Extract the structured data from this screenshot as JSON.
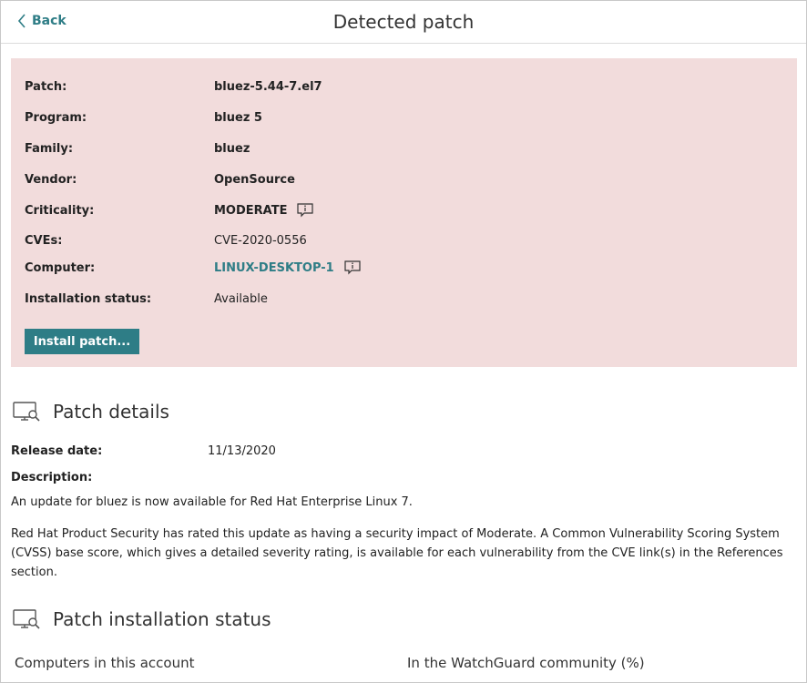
{
  "header": {
    "back_label": "Back",
    "title": "Detected patch"
  },
  "summary": {
    "patch_label": "Patch:",
    "patch_value": "bluez-5.44-7.el7",
    "program_label": "Program:",
    "program_value": "bluez 5",
    "family_label": "Family:",
    "family_value": "bluez",
    "vendor_label": "Vendor:",
    "vendor_value": "OpenSource",
    "criticality_label": "Criticality:",
    "criticality_value": "MODERATE",
    "cves_label": "CVEs:",
    "cves_value": "CVE-2020-0556",
    "computer_label": "Computer:",
    "computer_value": "LINUX-DESKTOP-1",
    "status_label": "Installation status:",
    "status_value": "Available",
    "install_button": "Install patch...",
    "background_color": "#f2dcdc",
    "accent_color": "#2e7d86"
  },
  "patch_details": {
    "heading": "Patch details",
    "release_label": "Release date:",
    "release_value": "11/13/2020",
    "description_label": "Description:",
    "paragraph_1": "An update for bluez is now available for Red Hat Enterprise Linux 7.",
    "paragraph_2": "Red Hat Product Security has rated this update as having a security impact of Moderate. A Common Vulnerability Scoring System (CVSS) base score, which gives a detailed severity rating, is available for each vulnerability from the CVE link(s) in the References section."
  },
  "installation_status": {
    "heading": "Patch installation status",
    "col_account": "Computers in this account",
    "col_community": "In the WatchGuard community (%)"
  },
  "icons": {
    "back": "chevron-left-icon",
    "info": "info-comment-icon",
    "section": "monitor-search-icon"
  }
}
